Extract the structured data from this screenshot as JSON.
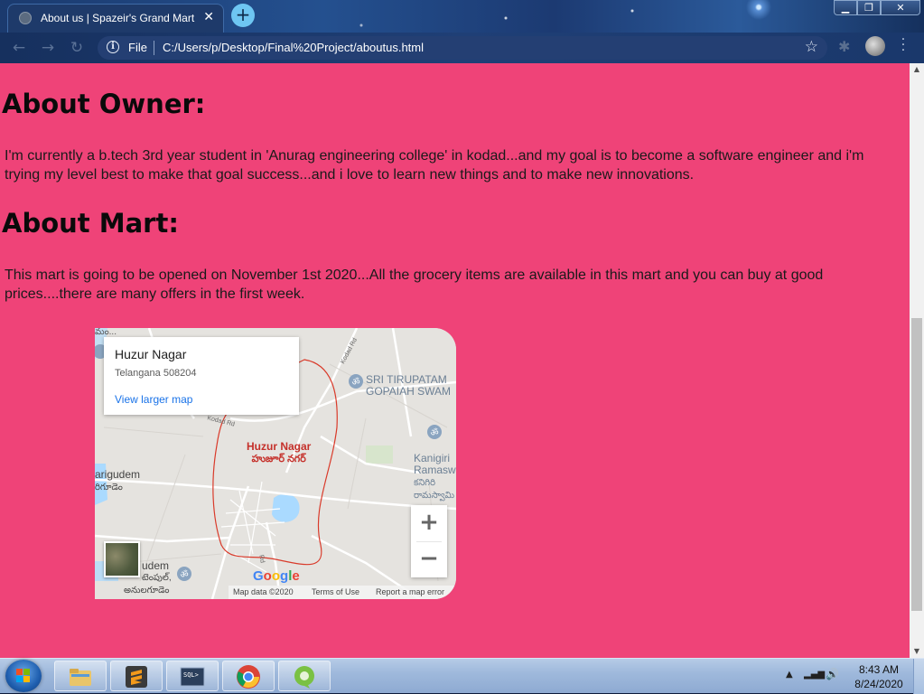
{
  "browser": {
    "tab_title": "About us | Spazeir's Grand Mart",
    "tab_close": "✕",
    "new_tab": "+",
    "address_scheme": "File",
    "address_url": "C:/Users/p/Desktop/Final%20Project/aboutus.html",
    "window": {
      "minimize": "▁",
      "maximize": "❐",
      "close": "✕"
    }
  },
  "page": {
    "owner_heading": "About Owner:",
    "owner_text": "I'm currently a b.tech 3rd year student in 'Anurag engineering college' in kodad...and my goal is to become a software engineer and i'm trying my level best to make that goal success...and i love to learn new things and to make new innovations.",
    "mart_heading": "About Mart:",
    "mart_text": "This mart is going to be opened on November 1st 2020...All the grocery items are available in this mart and you can buy at good prices....there are many offers in the first week."
  },
  "map": {
    "place_name": "Huzur Nagar",
    "place_address": "Telangana 508204",
    "larger_map_link": "View larger map",
    "center_label": "Huzur Nagar",
    "center_label_local": "హుజూర్ నగర్",
    "poi_1_line1": "SRI TIRUPATAM",
    "poi_1_line2": "GOPAIAH SWAM",
    "poi_2_line1": "Kanigiri",
    "poi_2_line2": "Ramasw",
    "poi_2_local_1": "కనిగిరి",
    "poi_2_local_2": "రామస్వామి",
    "west_label": "arigudem",
    "west_label_local": "రిగూడెం",
    "sw_label": "udem",
    "sw_label_local_1": "టెంపుల్,",
    "sw_label_local_2": "అనులగూడెం",
    "road_1": "Kodad Rd",
    "road_2": "Kodad Rd",
    "road_3": "Rd",
    "top_left_label": "మం...",
    "logo": "Google",
    "footer_data": "Map data ©2020",
    "footer_terms": "Terms of Use",
    "footer_report": "Report a map error",
    "zoom_in": "+",
    "zoom_out": "−"
  },
  "taskbar": {
    "time": "8:43 AM",
    "date": "8/24/2020",
    "apps": [
      "file-explorer",
      "sublime-text",
      "sql-tool",
      "chrome",
      "app-green"
    ]
  },
  "colors": {
    "page_background": "#ef4378",
    "link": "#1a73e8",
    "boundary": "#d93a2a"
  }
}
